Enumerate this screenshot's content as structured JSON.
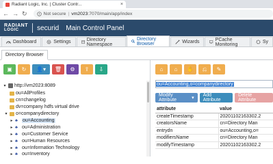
{
  "browser": {
    "tab_title": "Radiant Logic, Inc. | Cluster Contr...",
    "close_glyph": "×",
    "back_glyph": "←",
    "forward_glyph": "→",
    "reload_glyph": "↻",
    "security_label": "Not secure",
    "separator": "|",
    "url_host": "vm2023",
    "url_path": ":7070/main/app/index"
  },
  "app": {
    "brand_line1": "RADIANT",
    "brand_line2": "LOGIC",
    "product": "securid",
    "title": "Main Control Panel"
  },
  "main_tabs": [
    {
      "label": "Dashboard",
      "icon": "dashboard-icon",
      "active": false
    },
    {
      "label": "Settings",
      "icon": "gear-icon",
      "active": false
    },
    {
      "label": "Directory Namespace",
      "icon": "namespace-icon",
      "active": false
    },
    {
      "label": "Directory Browser",
      "icon": "search-icon",
      "active": true
    },
    {
      "label": "Wizards",
      "icon": "wand-icon",
      "active": false
    },
    {
      "label": "PCache Monitoring",
      "icon": "monitor-icon",
      "active": false
    },
    {
      "label": "Sy",
      "icon": "gear-icon",
      "active": false
    }
  ],
  "sub_tab": "Directory Browser",
  "left_toolbar_glyphs": {
    "monitor": "▣",
    "refresh": "↻",
    "add_user": "👤▾",
    "delete": "🗑",
    "settings": "⚙",
    "upload": "⇪",
    "download": "⇩"
  },
  "tree_glyphs": {
    "expanded": "▾",
    "collapsed": "▸",
    "ou": "♣"
  },
  "tree": [
    {
      "label": "http://vm2023:8089",
      "level": 0,
      "type": "server",
      "expanded": true
    },
    {
      "label": "ou=AllProfiles",
      "level": 1,
      "type": "folder"
    },
    {
      "label": "cn=changelog",
      "level": 1,
      "type": "folder"
    },
    {
      "label": "dv=company hdfs virtual drive",
      "level": 1,
      "type": "folder"
    },
    {
      "label": "o=companydirectory",
      "level": 1,
      "type": "folder",
      "expanded": true
    },
    {
      "label": "ou=Accounting",
      "level": 2,
      "type": "ou",
      "selected": true
    },
    {
      "label": "ou=Administration",
      "level": 2,
      "type": "ou"
    },
    {
      "label": "ou=Customer Service",
      "level": 2,
      "type": "ou"
    },
    {
      "label": "ou=Human Resources",
      "level": 2,
      "type": "ou"
    },
    {
      "label": "ou=Information Technology",
      "level": 2,
      "type": "ou"
    },
    {
      "label": "ou=Inventory",
      "level": 2,
      "type": "ou"
    }
  ],
  "right_toolbar_glyphs": [
    "⌂",
    "⌂",
    "✋",
    "⎌",
    "✎"
  ],
  "dn_value": "ou=Accounting,o=companydirectory",
  "attr_buttons": {
    "modify": "Modify Attribute",
    "modify_caret": "▾",
    "add": "Add Attribute",
    "delete": "Delete Attribute"
  },
  "attr_table": {
    "headers": [
      "attribute",
      "value"
    ],
    "rows": [
      [
        "createTimestamp",
        "20201102163302.2"
      ],
      [
        "creatorsName",
        "cn=Directory Man"
      ],
      [
        "entrydn",
        "ou=Accounting,o="
      ],
      [
        "modifiersName",
        "cn=Directory Man"
      ],
      [
        "modifyTimestamp",
        "20201102163302.2"
      ]
    ]
  }
}
